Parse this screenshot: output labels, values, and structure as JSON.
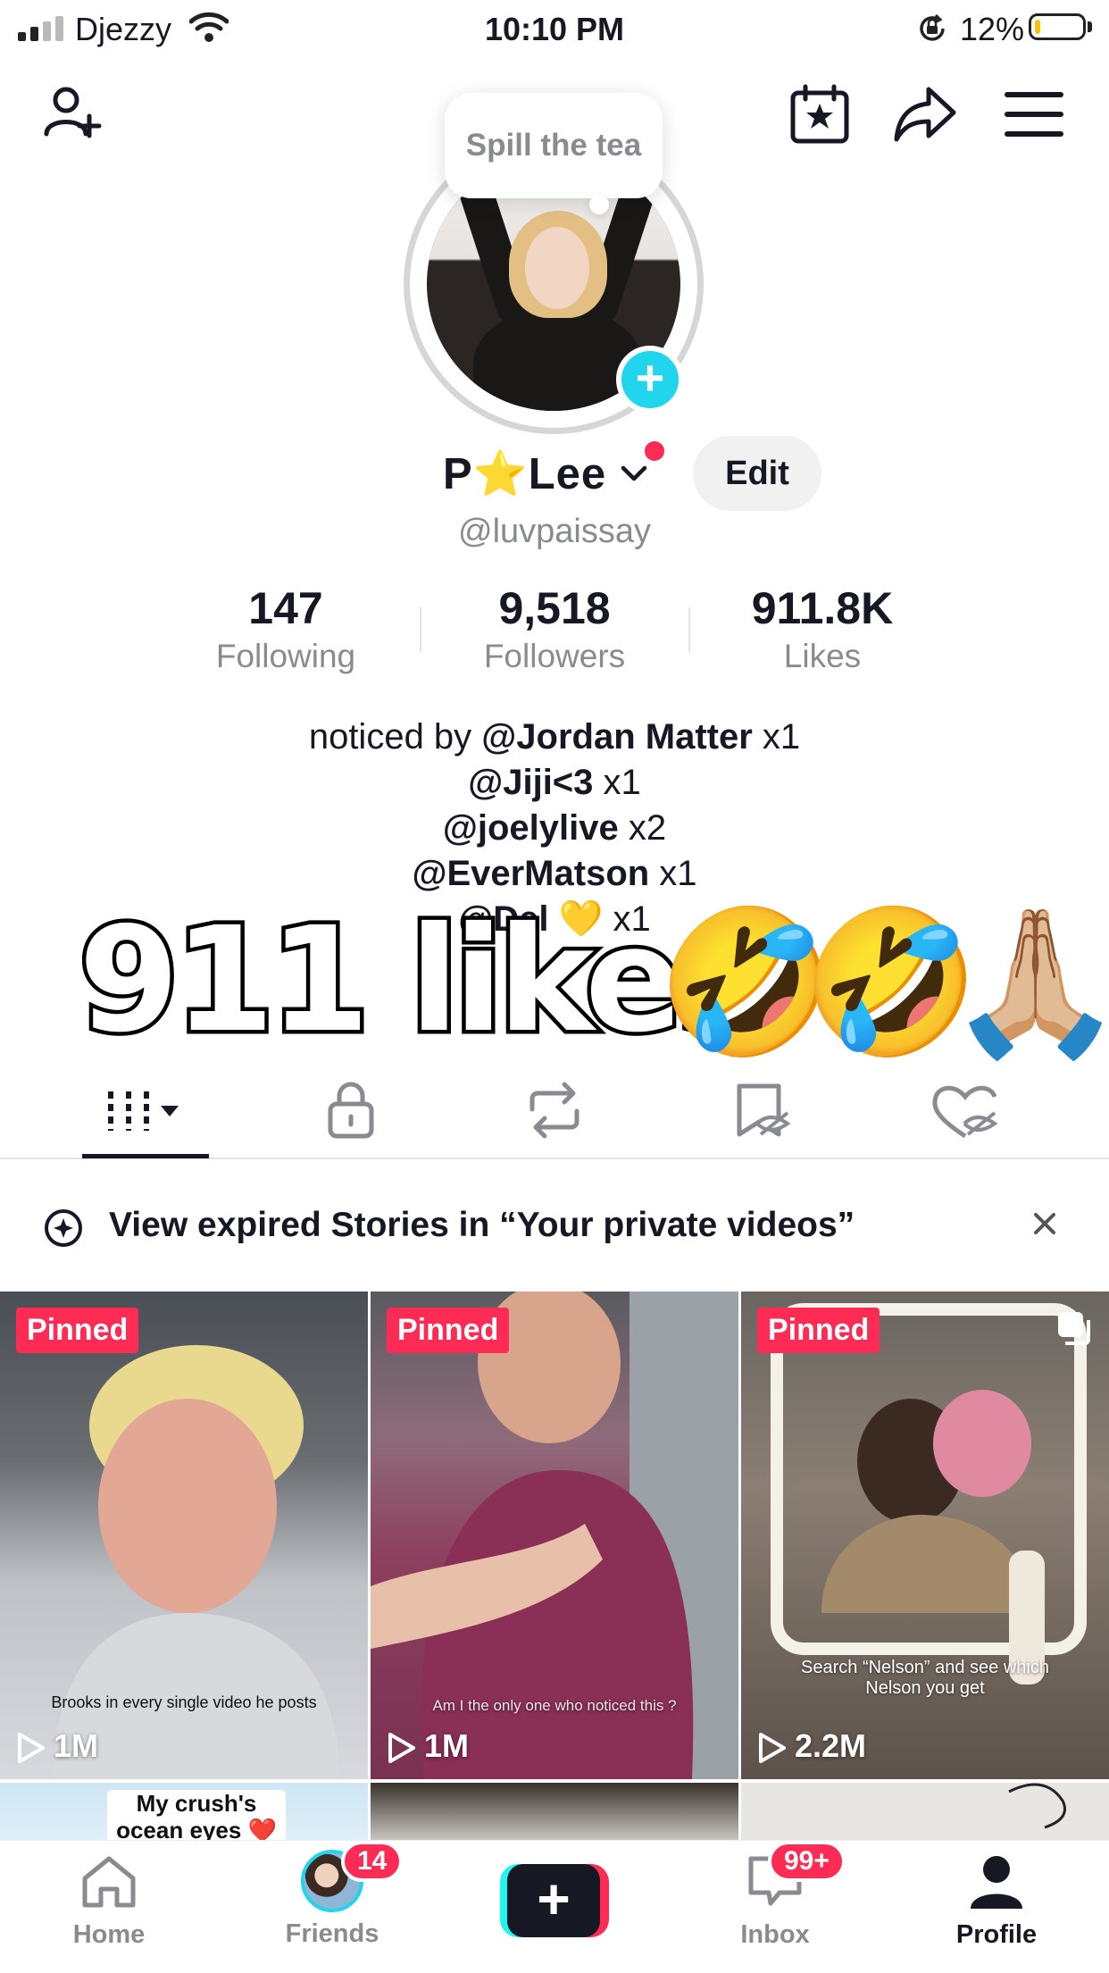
{
  "status_bar": {
    "carrier": "Djezzy",
    "time": "10:10 PM",
    "battery_percent": "12%",
    "battery_level": 0.12,
    "icons": [
      "signal-icon",
      "wifi-icon",
      "rotation-lock-icon",
      "battery-icon"
    ]
  },
  "header": {
    "icons": [
      "add-friend-icon",
      "calendar-star-icon",
      "share-icon",
      "menu-icon"
    ],
    "bubble_text": "Spill the tea"
  },
  "profile": {
    "display_name": "P⭐Lee",
    "edit_label": "Edit",
    "username": "@luvpaissay",
    "stats": [
      {
        "value": "147",
        "label": "Following"
      },
      {
        "value": "9,518",
        "label": "Followers"
      },
      {
        "value": "911.8K",
        "label": "Likes"
      }
    ],
    "bio": {
      "line1_prefix": "noticed by ",
      "line1_name": "@Jordan Matter",
      "line1_count": " x1",
      "line2_name": "@Jiji<3",
      "line2_count": " x1",
      "line3_name": "@joelylive",
      "line3_count": " x2",
      "line4_name": "@EverMatson",
      "line4_count": " x1",
      "line5_name": "@Del 💛",
      "line5_count": " x1"
    },
    "overlay_text": "911 likes",
    "overlay_emojis": [
      "🤣",
      "🤣",
      "🙏🏼"
    ]
  },
  "tabs": {
    "items": [
      "videos-grid-icon",
      "private-lock-icon",
      "repost-icon",
      "favorites-hidden-icon",
      "liked-hidden-icon"
    ],
    "active_index": 0
  },
  "notice": {
    "text": "View expired Stories in “Your private videos”"
  },
  "videos": [
    {
      "pinned": "Pinned",
      "caption": "Brooks in every single video he posts",
      "views": "1M"
    },
    {
      "pinned": "Pinned",
      "caption": "Am I the only one who noticed this ?",
      "views": "1M"
    },
    {
      "pinned": "Pinned",
      "caption": "Search “Nelson” and see which Nelson you get",
      "views": "2.2M"
    }
  ],
  "videos_row2": [
    {
      "caption": "My crush's ocean eyes ❤️"
    }
  ],
  "bottom_nav": {
    "items": [
      {
        "label": "Home",
        "icon": "home-icon"
      },
      {
        "label": "Friends",
        "icon": "friends-avatar",
        "badge": "14"
      },
      {
        "label": "",
        "icon": "create-plus-icon"
      },
      {
        "label": "Inbox",
        "icon": "inbox-icon",
        "badge": "99+"
      },
      {
        "label": "Profile",
        "icon": "profile-icon"
      }
    ],
    "active": "Profile"
  },
  "colors": {
    "accent_red": "#fe2c55",
    "accent_cyan": "#20d5ec",
    "text_primary": "#161823",
    "text_secondary": "#8a8b91"
  }
}
